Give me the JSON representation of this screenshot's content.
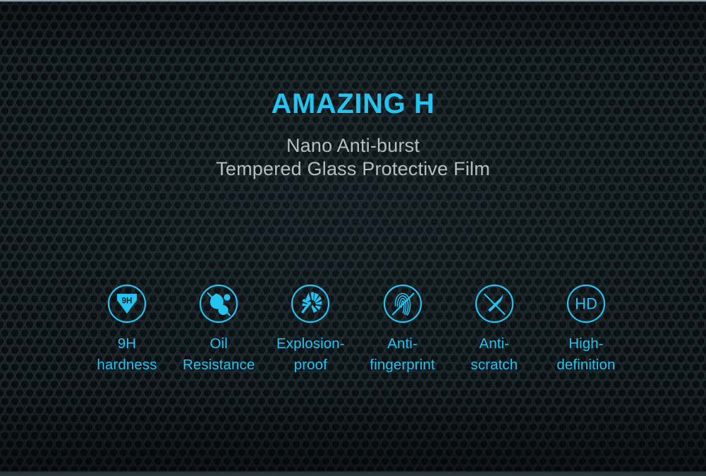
{
  "banner": {
    "headline": "AMAZING H",
    "subtitle_line1": "Nano Anti-burst",
    "subtitle_line2": "Tempered Glass Protective Film",
    "accent_color": "#24c3f0",
    "subtitle_color": "#b9bdbe",
    "background_color": "#14181b",
    "background_pattern": "honeycomb-hexagon-texture"
  },
  "features": [
    {
      "icon": "diamond-9h-icon",
      "icon_text": "9H",
      "label": "9H\nhardness",
      "label_line1": "9H",
      "label_line2": "hardness"
    },
    {
      "icon": "oil-droplet-no-icon",
      "icon_text": "",
      "label": "Oil\nResistance",
      "label_line1": "Oil",
      "label_line2": "Resistance"
    },
    {
      "icon": "shattered-glass-icon",
      "icon_text": "",
      "label": "Explosion-\nproof",
      "label_line1": "Explosion-",
      "label_line2": "proof"
    },
    {
      "icon": "fingerprint-no-icon",
      "icon_text": "",
      "label": "Anti-\nfingerprint",
      "label_line1": "Anti-",
      "label_line2": "fingerprint"
    },
    {
      "icon": "blade-no-scratch-icon",
      "icon_text": "",
      "label": "Anti-\nscratch",
      "label_line1": "Anti-",
      "label_line2": "scratch"
    },
    {
      "icon": "hd-badge-icon",
      "icon_text": "HD",
      "label": "High-\ndefinition",
      "label_line1": "High-",
      "label_line2": "definition"
    }
  ]
}
